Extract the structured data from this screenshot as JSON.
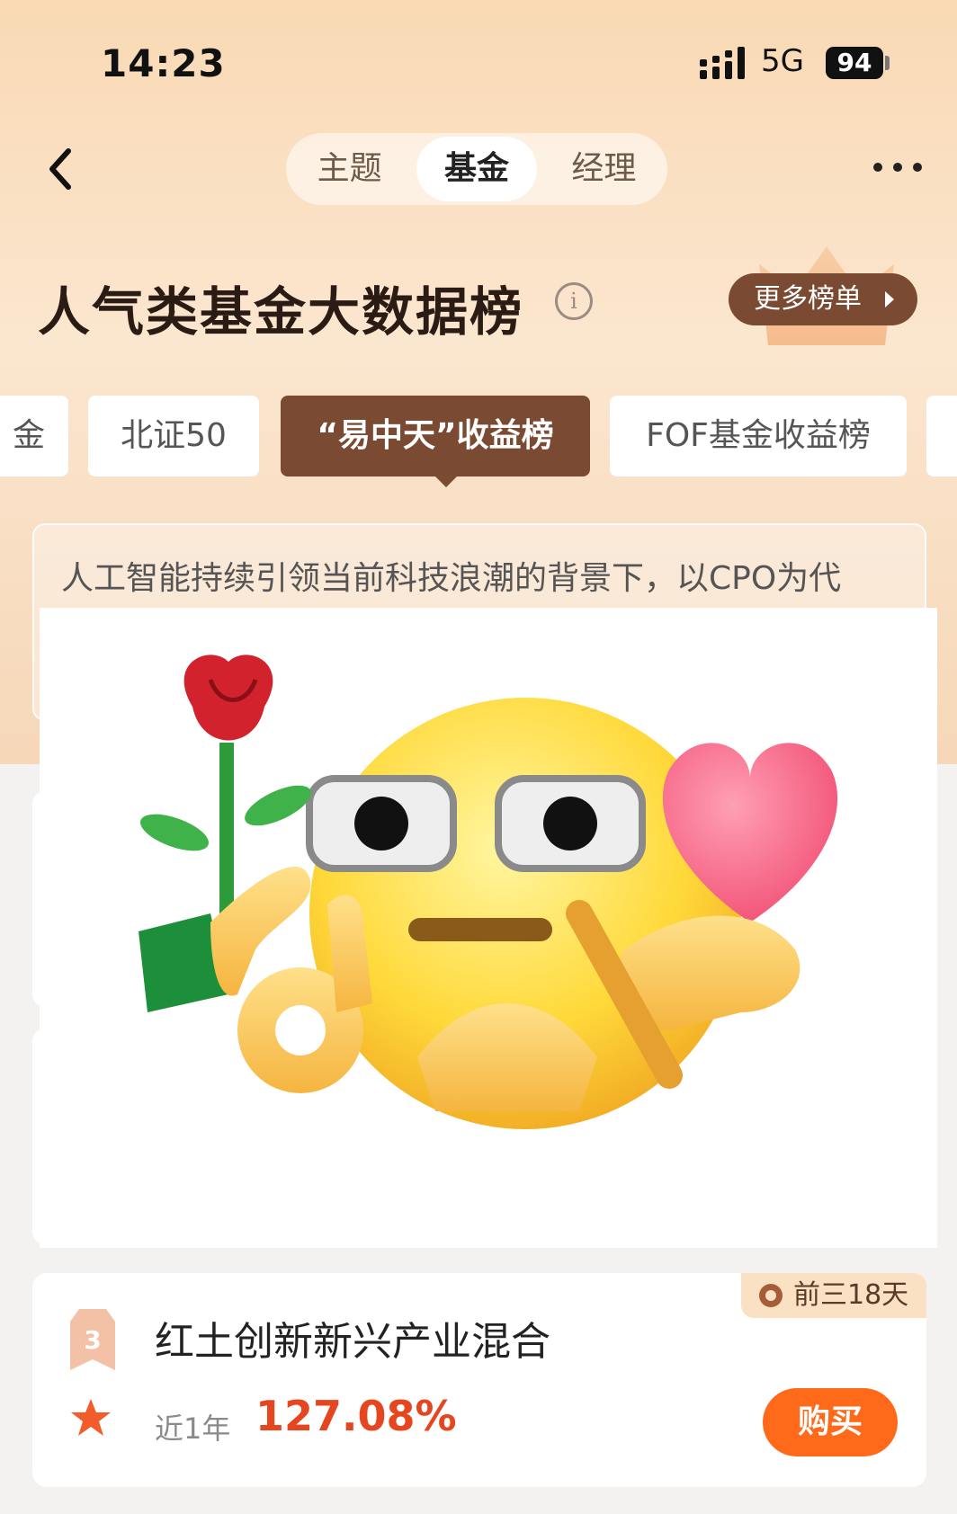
{
  "status_bar": {
    "time": "14:23",
    "network": "5G",
    "battery": "94"
  },
  "nav": {
    "tabs": [
      {
        "label": "主题",
        "active": false
      },
      {
        "label": "基金",
        "active": true
      },
      {
        "label": "经理",
        "active": false
      }
    ]
  },
  "header": {
    "title": "人气类基金大数据榜",
    "more_ranks_label": "更多榜单"
  },
  "chips": [
    {
      "label": "金",
      "active": false
    },
    {
      "label": "北证50",
      "active": false
    },
    {
      "label": "“易中天”收益榜",
      "active": true
    },
    {
      "label": "FOF基金收益榜",
      "active": false
    }
  ],
  "description": "人工智能持续引领当前科技浪潮的背景下，以CPO为代",
  "fund": {
    "badge": "前三18天",
    "rank": "3",
    "name": "红土创新新兴产业混合",
    "period": "近1年",
    "return": "127.08%",
    "buy_label": "购买"
  },
  "colors": {
    "accent": "#7a4a33",
    "buy": "#ff6a1a",
    "return": "#e5451f"
  }
}
